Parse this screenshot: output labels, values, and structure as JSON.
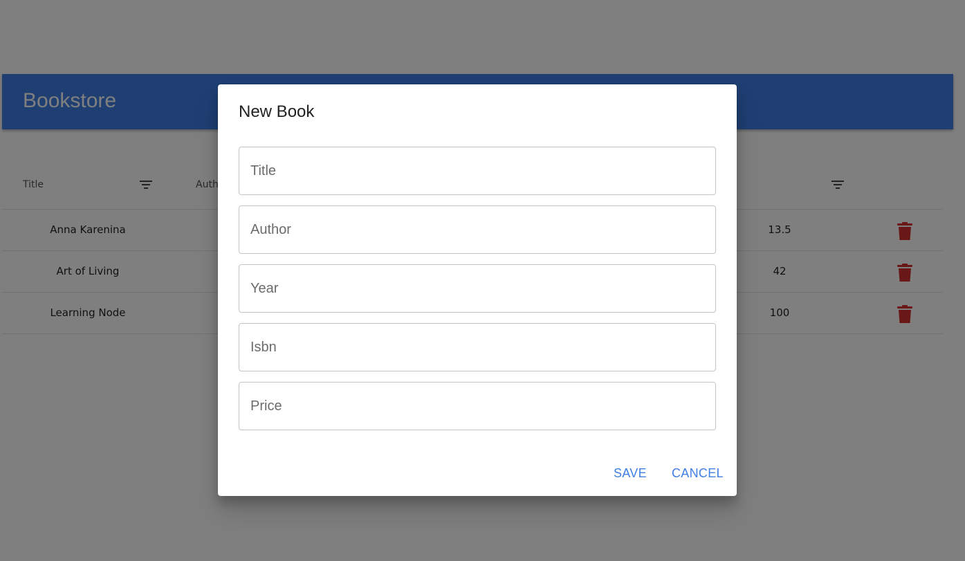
{
  "app": {
    "title": "Bookstore"
  },
  "colors": {
    "primary": "#3f7fe6",
    "delete": "#d32f2f",
    "overlay": "rgba(0,0,0,0.5)"
  },
  "grid": {
    "columns": [
      "Title",
      "Auth"
    ],
    "rows": [
      {
        "title": "Anna Karenina",
        "price": "13.5"
      },
      {
        "title": "Art of Living",
        "price": "42"
      },
      {
        "title": "Learning Node",
        "price": "100"
      }
    ]
  },
  "dialog": {
    "title": "New Book",
    "fields": {
      "title": {
        "placeholder": "Title",
        "value": ""
      },
      "author": {
        "placeholder": "Author",
        "value": ""
      },
      "year": {
        "placeholder": "Year",
        "value": ""
      },
      "isbn": {
        "placeholder": "Isbn",
        "value": ""
      },
      "price": {
        "placeholder": "Price",
        "value": ""
      }
    },
    "save_label": "SAVE",
    "cancel_label": "CANCEL"
  },
  "icons": {
    "filter": "filter-icon",
    "delete": "trash-icon"
  }
}
